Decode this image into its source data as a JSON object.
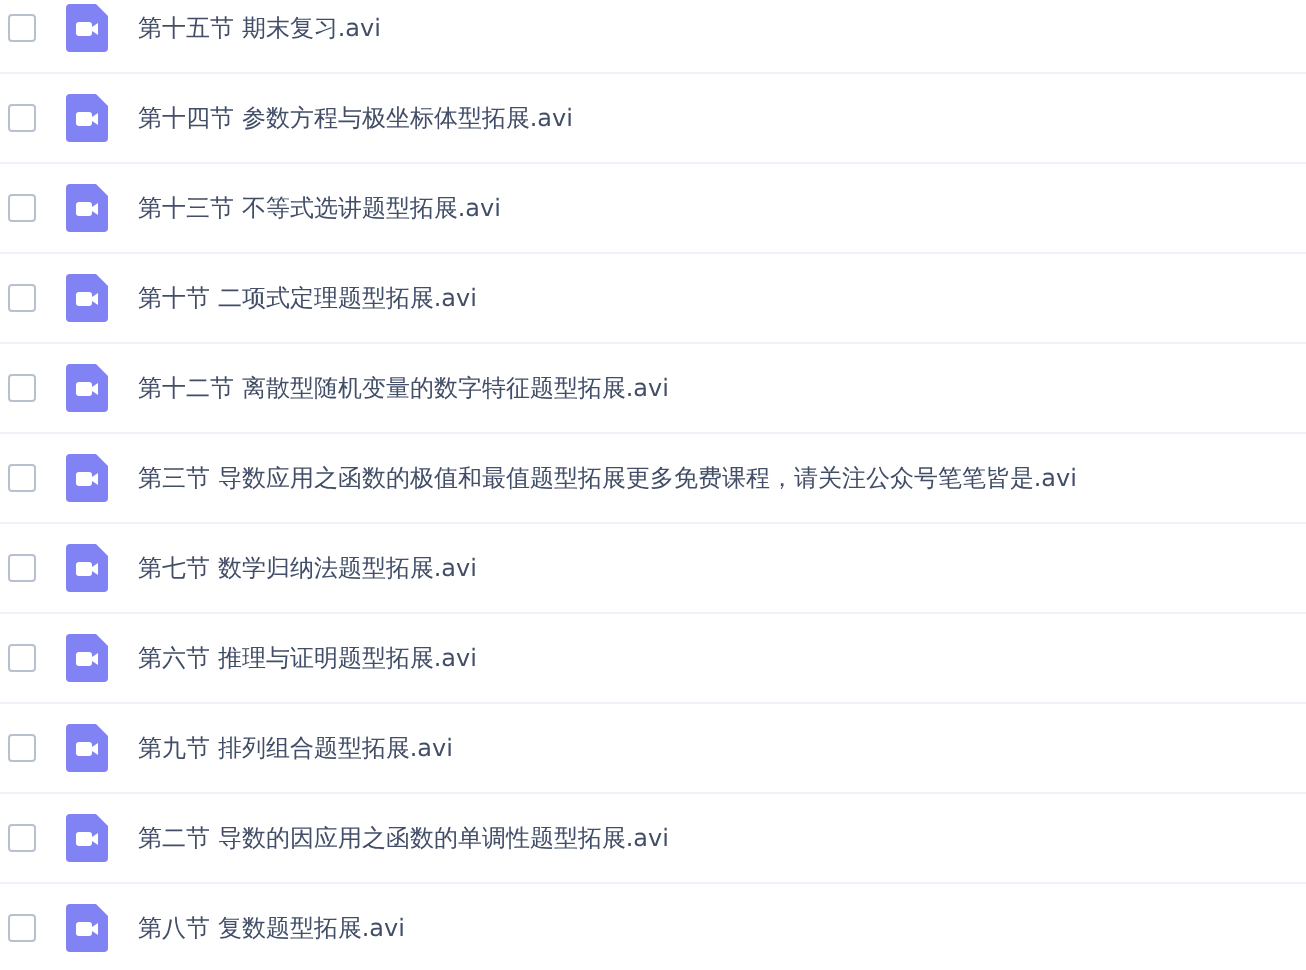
{
  "files": [
    {
      "name": "第十五节 期末复习.avi",
      "checked": false
    },
    {
      "name": "第十四节 参数方程与极坐标体型拓展.avi",
      "checked": false
    },
    {
      "name": "第十三节 不等式选讲题型拓展.avi",
      "checked": false
    },
    {
      "name": "第十节 二项式定理题型拓展.avi",
      "checked": false
    },
    {
      "name": "第十二节 离散型随机变量的数字特征题型拓展.avi",
      "checked": false
    },
    {
      "name": "第三节 导数应用之函数的极值和最值题型拓展更多免费课程，请关注公众号笔笔皆是.avi",
      "checked": false
    },
    {
      "name": "第七节 数学归纳法题型拓展.avi",
      "checked": false
    },
    {
      "name": "第六节 推理与证明题型拓展.avi",
      "checked": false
    },
    {
      "name": "第九节 排列组合题型拓展.avi",
      "checked": false
    },
    {
      "name": "第二节 导数的因应用之函数的单调性题型拓展.avi",
      "checked": false
    },
    {
      "name": "第八节 复数题型拓展.avi",
      "checked": false
    }
  ]
}
